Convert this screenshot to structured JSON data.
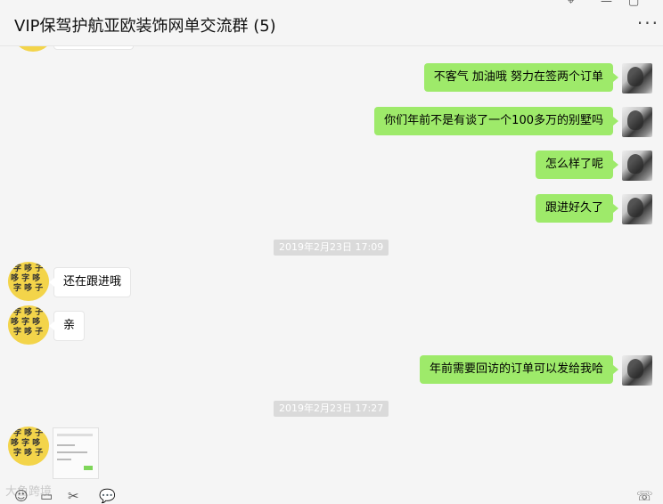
{
  "header": {
    "title": "VIP保驾护航亚欧装饰网单交流群 (5)",
    "pin_icon": "pin-icon",
    "minimize_icon": "minimize-icon",
    "maximize_icon": "maximize-icon",
    "more_icon": "more-icon"
  },
  "messages": [
    {
      "side": "me",
      "text": "不客气  加油哦  努力在签两个订单"
    },
    {
      "side": "me",
      "text": "你们年前不是有谈了一个100多万的别墅吗"
    },
    {
      "side": "me",
      "text": "怎么样了呢"
    },
    {
      "side": "me",
      "text": "跟进好久了"
    },
    {
      "side": "time",
      "text": "2019年2月23日 17:09"
    },
    {
      "side": "other",
      "text": "还在跟进哦"
    },
    {
      "side": "other",
      "text": "亲"
    },
    {
      "side": "me",
      "text": "年前需要回访的订单可以发给我哈"
    },
    {
      "side": "time",
      "text": "2019年2月23日 17:27"
    },
    {
      "side": "other",
      "type": "image"
    }
  ],
  "toolbar": {
    "icons": [
      "emoji-icon",
      "folder-icon",
      "scissors-icon",
      "chat-history-icon",
      "video-call-icon"
    ],
    "watermark": "大鱼跨境"
  },
  "colors": {
    "my_bubble": "#9eea6a",
    "other_bubble": "#ffffff",
    "background": "#f5f5f5",
    "timestamp_bg": "#dadada"
  }
}
